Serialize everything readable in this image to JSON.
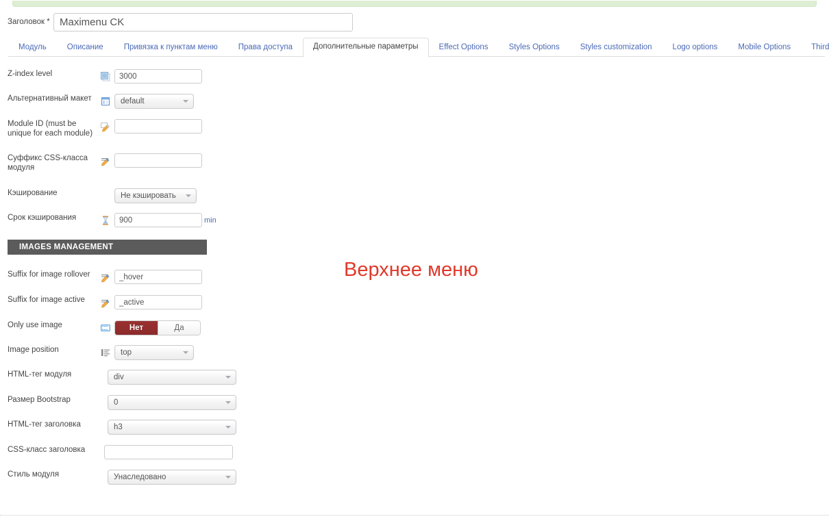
{
  "alert": {
    "name": "success-message-bar",
    "color": "#ddeed4"
  },
  "title": {
    "label": "Заголовок *",
    "value": "Maximenu CK"
  },
  "tabs": [
    {
      "label": "Модуль",
      "active": false
    },
    {
      "label": "Описание",
      "active": false
    },
    {
      "label": "Привязка к пунктам меню",
      "active": false
    },
    {
      "label": "Права доступа",
      "active": false
    },
    {
      "label": "Дополнительные параметры",
      "active": true
    },
    {
      "label": "Effect Options",
      "active": false
    },
    {
      "label": "Styles Options",
      "active": false
    },
    {
      "label": "Styles customization",
      "active": false
    },
    {
      "label": "Logo options",
      "active": false
    },
    {
      "label": "Mobile Options",
      "active": false
    },
    {
      "label": "Third party extensions Options",
      "active": false
    }
  ],
  "fields": {
    "zindex": {
      "label": "Z-index level",
      "value": "3000",
      "icon": "zindex-layers-icon"
    },
    "layout": {
      "label": "Альтернативный макет",
      "value": "default",
      "icon": "layout-window-icon"
    },
    "module_id": {
      "label": "Module ID (must be unique for each module)",
      "value": "",
      "icon": "pencil-note-icon"
    },
    "css_suffix": {
      "label": "Суффикс CSS-класса модуля",
      "value": "",
      "icon": "pencil-write-icon"
    },
    "caching": {
      "label": "Кэширование",
      "value": "Не кэшировать"
    },
    "cache_time": {
      "label": "Срок кэширования",
      "value": "900",
      "unit": "min",
      "icon": "hourglass-icon"
    },
    "img_rollover": {
      "label": "Suffix for image rollover",
      "value": "_hover",
      "icon": "pencil-write-icon"
    },
    "img_active": {
      "label": "Suffix for image active",
      "value": "_active",
      "icon": "pencil-write-icon"
    },
    "only_image": {
      "label": "Only use image",
      "icon": "image-strip-icon",
      "options": [
        "Нет",
        "Да"
      ],
      "selected": "Нет"
    },
    "image_position": {
      "label": "Image position",
      "value": "top",
      "icon": "list-align-icon"
    },
    "module_tag": {
      "label": "HTML-тег модуля",
      "value": "div"
    },
    "bootstrap_size": {
      "label": "Размер Bootstrap",
      "value": "0"
    },
    "header_tag": {
      "label": "HTML-тег заголовка",
      "value": "h3"
    },
    "header_class": {
      "label": "CSS-класс заголовка",
      "value": ""
    },
    "module_style": {
      "label": "Стиль модуля",
      "value": "Унаследовано"
    }
  },
  "sections": {
    "images_management": "IMAGES MANAGEMENT"
  },
  "preview": {
    "text": "Верхнее меню",
    "color": "#e0392b"
  }
}
